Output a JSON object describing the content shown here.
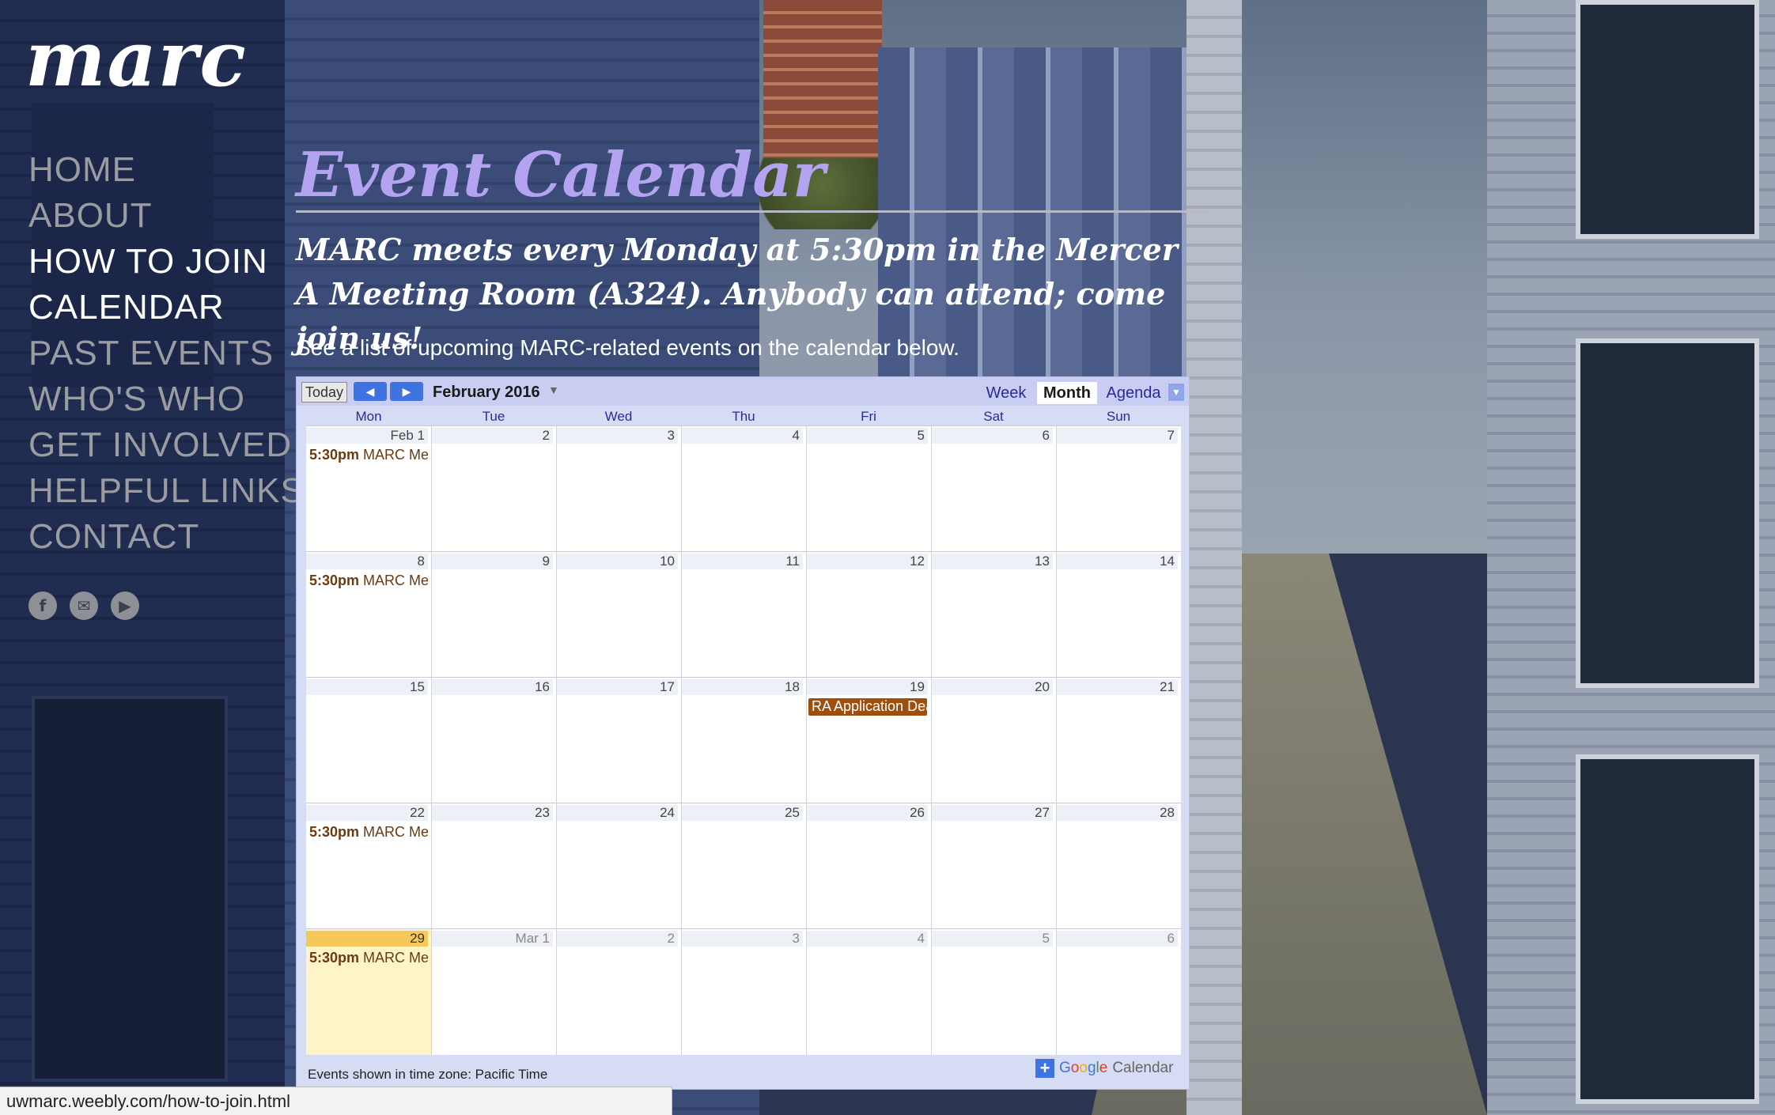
{
  "site": {
    "logo": "marc",
    "nav": [
      {
        "label": "HOME",
        "active": false
      },
      {
        "label": "ABOUT",
        "active": false
      },
      {
        "label": "HOW TO JOIN",
        "active": true
      },
      {
        "label": "CALENDAR",
        "active": true
      },
      {
        "label": "PAST EVENTS",
        "active": false
      },
      {
        "label": "WHO'S WHO",
        "active": false
      },
      {
        "label": "GET INVOLVED",
        "active": false
      },
      {
        "label": "HELPFUL LINKS",
        "active": false
      },
      {
        "label": "CONTACT",
        "active": false
      }
    ],
    "social": [
      {
        "icon": "facebook-icon",
        "glyph": "f"
      },
      {
        "icon": "email-icon",
        "glyph": "✉"
      },
      {
        "icon": "youtube-icon",
        "glyph": "▶"
      }
    ]
  },
  "content": {
    "title": "Event Calendar",
    "tagline": "MARC meets every Monday at 5:30pm in the Mercer A Meeting Room (A324). Anybody can attend; come join us!",
    "intro": "See a list of upcoming MARC-related events on the calendar below."
  },
  "calendar": {
    "today_label": "Today",
    "prev_icon": "chevron-left-icon",
    "next_icon": "chevron-right-icon",
    "month_label": "February 2016",
    "views": {
      "week": "Week",
      "month": "Month",
      "agenda": "Agenda",
      "selected": "Month"
    },
    "days_of_week": [
      "Mon",
      "Tue",
      "Wed",
      "Thu",
      "Fri",
      "Sat",
      "Sun"
    ],
    "weeks": [
      {
        "days": [
          {
            "label": "Feb 1",
            "other": false,
            "event": {
              "time": "5:30pm",
              "title": "MARC Meeting"
            }
          },
          {
            "label": "2"
          },
          {
            "label": "3"
          },
          {
            "label": "4"
          },
          {
            "label": "5"
          },
          {
            "label": "6"
          },
          {
            "label": "7"
          }
        ]
      },
      {
        "days": [
          {
            "label": "8",
            "event": {
              "time": "5:30pm",
              "title": "MARC Meeting"
            }
          },
          {
            "label": "9"
          },
          {
            "label": "10"
          },
          {
            "label": "11"
          },
          {
            "label": "12"
          },
          {
            "label": "13"
          },
          {
            "label": "14"
          }
        ]
      },
      {
        "days": [
          {
            "label": "15"
          },
          {
            "label": "16"
          },
          {
            "label": "17"
          },
          {
            "label": "18"
          },
          {
            "label": "19",
            "allday": "RA Application Deadline"
          },
          {
            "label": "20"
          },
          {
            "label": "21"
          }
        ]
      },
      {
        "days": [
          {
            "label": "22",
            "event": {
              "time": "5:30pm",
              "title": "MARC Meeting"
            }
          },
          {
            "label": "23"
          },
          {
            "label": "24"
          },
          {
            "label": "25"
          },
          {
            "label": "26"
          },
          {
            "label": "27"
          },
          {
            "label": "28"
          }
        ]
      },
      {
        "days": [
          {
            "label": "29",
            "today": true,
            "event": {
              "time": "5:30pm",
              "title": "MARC Meeting"
            }
          },
          {
            "label": "Mar 1",
            "other": true
          },
          {
            "label": "2",
            "other": true
          },
          {
            "label": "3",
            "other": true
          },
          {
            "label": "4",
            "other": true
          },
          {
            "label": "5",
            "other": true
          },
          {
            "label": "6",
            "other": true
          }
        ]
      }
    ],
    "timezone_note": "Events shown in time zone: Pacific Time",
    "google_calendar": {
      "brand": "Google",
      "suffix": "Calendar"
    }
  },
  "status_bar": {
    "url": "uwmarc.weebly.com/how-to-join.html"
  },
  "colors": {
    "title": "#b3a3f0",
    "nav_active": "#ffffff",
    "nav_inactive": "#9a9ca2",
    "event_text": "#6b3a10",
    "allday_event": "#9e4f0e",
    "today_cell": "#fff4c8"
  }
}
